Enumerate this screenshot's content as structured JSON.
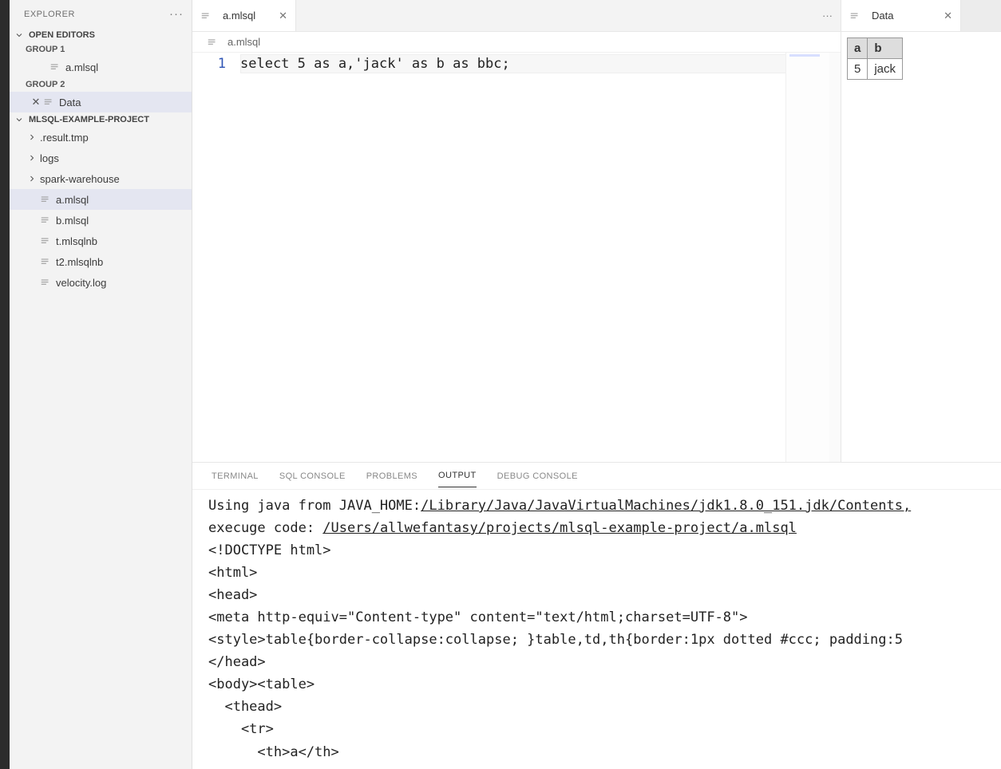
{
  "sidebar": {
    "title": "EXPLORER",
    "sections": {
      "openEditors": {
        "label": "OPEN EDITORS",
        "groups": [
          {
            "label": "GROUP 1",
            "items": [
              {
                "name": "a.mlsql"
              }
            ]
          },
          {
            "label": "GROUP 2",
            "items": [
              {
                "name": "Data",
                "active": true
              }
            ]
          }
        ]
      },
      "project": {
        "label": "MLSQL-EXAMPLE-PROJECT",
        "items": [
          {
            "name": ".result.tmp",
            "kind": "folder"
          },
          {
            "name": "logs",
            "kind": "folder"
          },
          {
            "name": "spark-warehouse",
            "kind": "folder"
          },
          {
            "name": "a.mlsql",
            "kind": "file",
            "active": true
          },
          {
            "name": "b.mlsql",
            "kind": "file"
          },
          {
            "name": "t.mlsqlnb",
            "kind": "file"
          },
          {
            "name": "t2.mlsqlnb",
            "kind": "file"
          },
          {
            "name": "velocity.log",
            "kind": "file"
          }
        ]
      }
    }
  },
  "editor": {
    "tabs": [
      {
        "label": "a.mlsql",
        "active": true
      }
    ],
    "breadcrumb": "a.mlsql",
    "lineNumber": "1",
    "code": "select 5 as a,'jack' as b as bbc;"
  },
  "dataPane": {
    "tab": "Data",
    "headers": [
      "a",
      "b"
    ],
    "row": [
      "5",
      "jack"
    ]
  },
  "panel": {
    "tabs": {
      "terminal": "TERMINAL",
      "sqlConsole": "SQL CONSOLE",
      "problems": "PROBLEMS",
      "output": "OUTPUT",
      "debug": "DEBUG CONSOLE"
    },
    "activeTab": "output",
    "output": {
      "line1a": "Using java from JAVA_HOME:",
      "line1b": "/Library/Java/JavaVirtualMachines/jdk1.8.0_151.jdk/Contents,",
      "line2a": "execuge code: ",
      "line2b": "/Users/allwefantasy/projects/mlsql-example-project/a.mlsql",
      "line3": "<!DOCTYPE html>",
      "line4": "<html>",
      "line5": "<head>",
      "line6": "<meta http-equiv=\"Content-type\" content=\"text/html;charset=UTF-8\">",
      "line7": "<style>table{border-collapse:collapse; }table,td,th{border:1px dotted #ccc; padding:5",
      "line8": "</head>",
      "line9": "<body><table>",
      "line10": "  <thead>",
      "line11": "    <tr>",
      "line12": "      <th>a</th>"
    }
  }
}
